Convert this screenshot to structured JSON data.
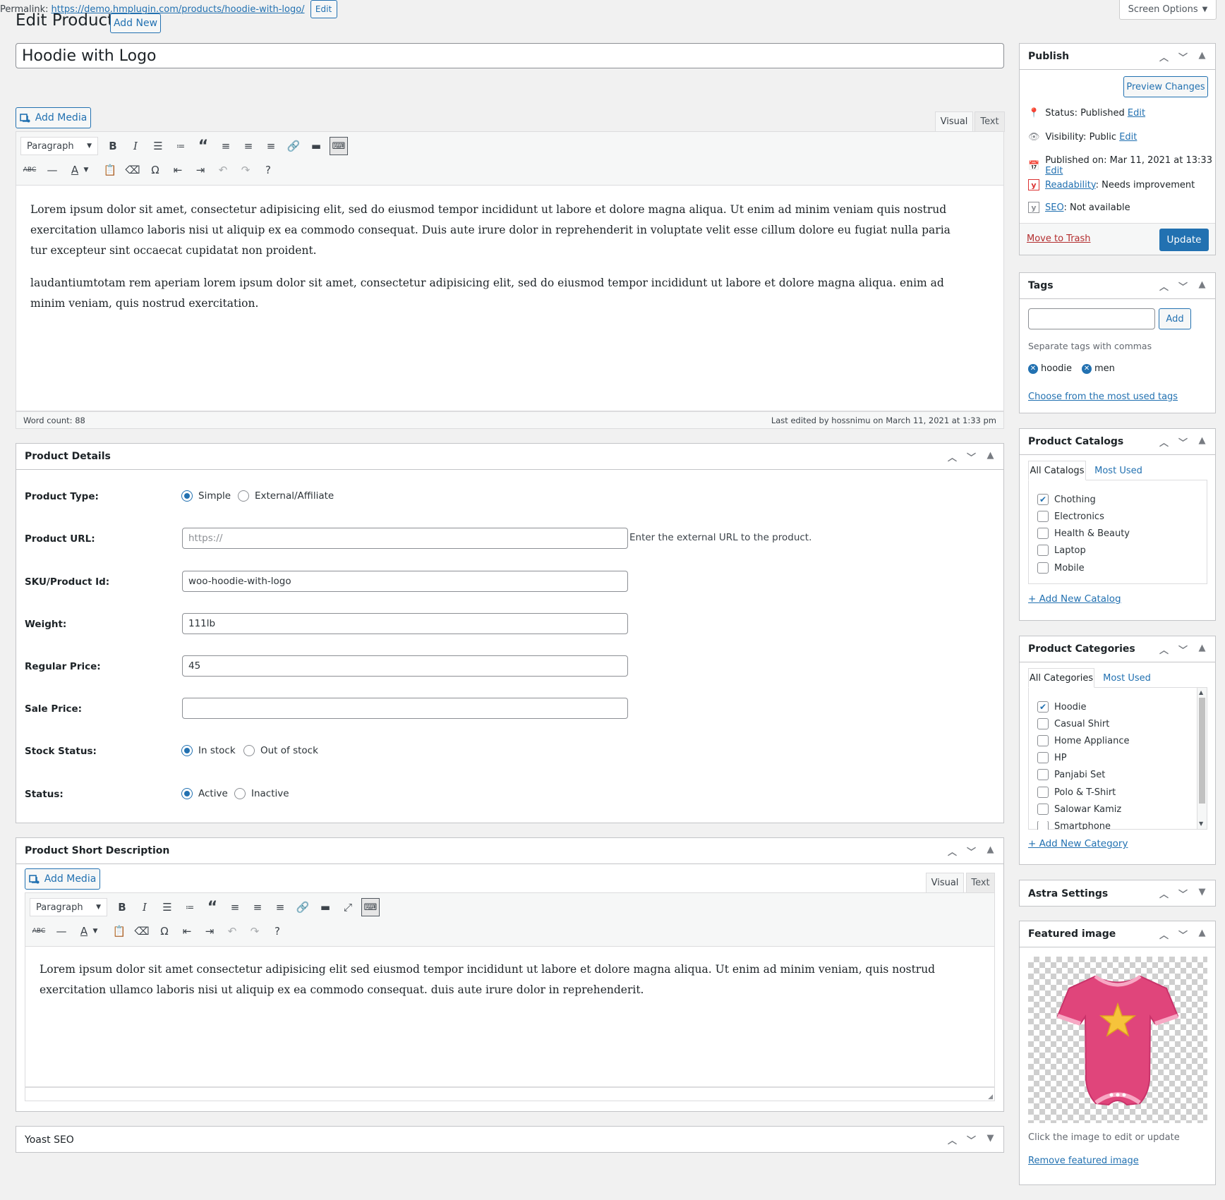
{
  "header": {
    "screen_options": "Screen Options",
    "title": "Edit Product",
    "add_new": "Add New"
  },
  "post": {
    "title": "Hoodie with Logo",
    "permalink_label": "Permalink:",
    "permalink_url": "https://demo.hmplugin.com/products/hoodie-with-logo/",
    "permalink_edit": "Edit"
  },
  "editor": {
    "add_media": "Add Media",
    "tab_visual": "Visual",
    "tab_text": "Text",
    "format_select": "Paragraph",
    "paragraphs": [
      "Lorem ipsum dolor sit amet, consectetur adipisicing elit, sed do eiusmod tempor incididunt ut labore et dolore magna aliqua. Ut enim ad minim veniam quis nostrud exercitation ullamco laboris nisi ut aliquip ex ea commodo consequat. Duis aute irure dolor in reprehenderit in voluptate velit esse cillum dolore eu fugiat nulla paria tur excepteur sint occaecat cupidatat non proident.",
      "laudantiumtotam rem aperiam lorem ipsum dolor sit amet, consectetur adipisicing elit, sed do eiusmod tempor incididunt ut labore et dolore magna aliqua. enim ad minim veniam, quis nostrud exercitation."
    ],
    "word_count": "Word count: 88",
    "last_edited": "Last edited by hossnimu on March 11, 2021 at 1:33 pm"
  },
  "product_details": {
    "title": "Product Details",
    "type_label": "Product Type:",
    "type_options": [
      "Simple",
      "External/Affiliate"
    ],
    "url_label": "Product URL:",
    "url_placeholder": "https://",
    "url_hint": "Enter the external URL to the product.",
    "sku_label": "SKU/Product Id:",
    "sku_value": "woo-hoodie-with-logo",
    "weight_label": "Weight:",
    "weight_value": "111lb",
    "regular_price_label": "Regular Price:",
    "regular_price_value": "45",
    "sale_price_label": "Sale Price:",
    "sale_price_value": "",
    "stock_label": "Stock Status:",
    "stock_options": [
      "In stock",
      "Out of stock"
    ],
    "status_label": "Status:",
    "status_options": [
      "Active",
      "Inactive"
    ]
  },
  "short_description": {
    "title": "Product Short Description",
    "add_media": "Add Media",
    "tab_visual": "Visual",
    "tab_text": "Text",
    "format_select": "Paragraph",
    "text": "Lorem ipsum dolor sit amet consectetur adipisicing elit sed eiusmod tempor incididunt ut labore et dolore magna aliqua. Ut enim ad minim veniam, quis nostrud exercitation ullamco laboris nisi ut aliquip ex ea commodo consequat. duis aute irure dolor in reprehenderit."
  },
  "yoast": {
    "title": "Yoast SEO"
  },
  "publish": {
    "title": "Publish",
    "preview": "Preview Changes",
    "status_label": "Status:",
    "status_value": "Published",
    "visibility_label": "Visibility:",
    "visibility_value": "Public",
    "published_label": "Published on:",
    "published_value": "Mar 11, 2021 at 13:33",
    "edit": "Edit",
    "readability_link": "Readability",
    "readability_value": ": Needs improvement",
    "seo_link": "SEO",
    "seo_value": ": Not available",
    "trash": "Move to Trash",
    "update": "Update"
  },
  "tags": {
    "title": "Tags",
    "add": "Add",
    "hint": "Separate tags with commas",
    "items": [
      "hoodie",
      "men"
    ],
    "choose": "Choose from the most used tags"
  },
  "catalogs": {
    "title": "Product Catalogs",
    "tab_all": "All Catalogs",
    "tab_most": "Most Used",
    "items": [
      {
        "label": "Chothing",
        "checked": true
      },
      {
        "label": "Electronics",
        "checked": false
      },
      {
        "label": "Health & Beauty",
        "checked": false
      },
      {
        "label": "Laptop",
        "checked": false
      },
      {
        "label": "Mobile",
        "checked": false
      }
    ],
    "add_new": "+ Add New Catalog"
  },
  "categories": {
    "title": "Product Categories",
    "tab_all": "All Categories",
    "tab_most": "Most Used",
    "items": [
      {
        "label": "Hoodie",
        "checked": true
      },
      {
        "label": "Casual Shirt",
        "checked": false
      },
      {
        "label": "Home Appliance",
        "checked": false
      },
      {
        "label": "HP",
        "checked": false
      },
      {
        "label": "Panjabi Set",
        "checked": false
      },
      {
        "label": "Polo & T-Shirt",
        "checked": false
      },
      {
        "label": "Salowar Kamiz",
        "checked": false
      },
      {
        "label": "Smartphone",
        "checked": false
      }
    ],
    "add_new": "+ Add New Category"
  },
  "astra": {
    "title": "Astra Settings"
  },
  "featured": {
    "title": "Featured image",
    "hint": "Click the image to edit or update",
    "remove": "Remove featured image"
  },
  "colors": {
    "accent": "#2271b1",
    "trash": "#b32d2e",
    "onesie": "#e0457b"
  }
}
